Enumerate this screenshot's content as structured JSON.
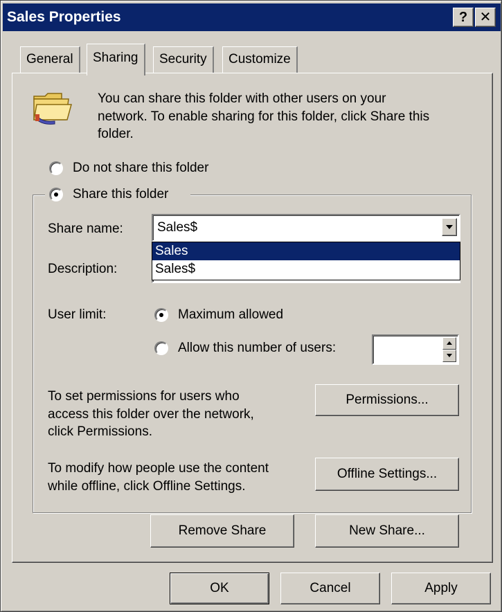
{
  "window": {
    "title": "Sales Properties",
    "help_glyph": "?",
    "close_glyph": "✕"
  },
  "tabs": [
    {
      "label": "General"
    },
    {
      "label": "Sharing"
    },
    {
      "label": "Security"
    },
    {
      "label": "Customize"
    }
  ],
  "sharing": {
    "info_line1": "You can share this folder with other users on your",
    "info_line2": "network.  To enable sharing for this folder, click Share this",
    "info_line3": "folder.",
    "option_do_not_share": "Do not share this folder",
    "option_share": "Share this folder",
    "share_name_label": "Share name:",
    "share_name_value": "Sales$",
    "share_name_options": [
      "Sales",
      "Sales$"
    ],
    "description_label": "Description:",
    "user_limit_label": "User limit:",
    "maximum_allowed": "Maximum allowed",
    "allow_number": "Allow this number of users:",
    "permissions_text1": "To set permissions for users who",
    "permissions_text2": "access this folder over the network,",
    "permissions_text3": "click Permissions.",
    "permissions_button": "Permissions...",
    "offline_text1": "To modify how people use the content",
    "offline_text2": "while offline, click Offline Settings.",
    "offline_button": "Offline Settings...",
    "remove_share_button": "Remove Share",
    "new_share_button": "New Share..."
  },
  "footer": {
    "ok": "OK",
    "cancel": "Cancel",
    "apply": "Apply"
  },
  "colors": {
    "titlebar": "#0a246a",
    "face": "#d4d0c8",
    "selection": "#0a246a"
  },
  "icons": {
    "folder": "shared-folder-icon"
  }
}
